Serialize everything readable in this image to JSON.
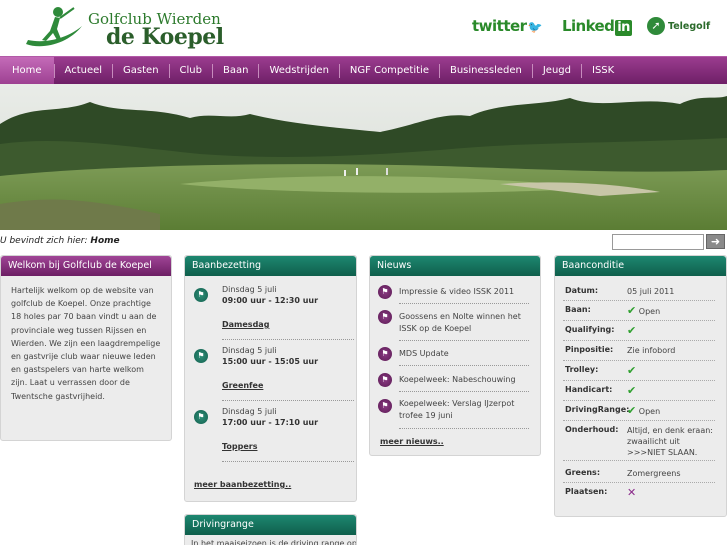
{
  "header": {
    "logo_line1": "Golfclub Wierden",
    "logo_line2": "de Koepel",
    "twitter": "twitter",
    "linkedin": "Linked",
    "linkedin_in": "in",
    "telegolf": "Telegolf"
  },
  "nav": {
    "items": [
      "Home",
      "Actueel",
      "Gasten",
      "Club",
      "Baan",
      "Wedstrijden",
      "NGF Competitie",
      "Businessleden",
      "Jeugd",
      "ISSK"
    ]
  },
  "breadcrumb": {
    "prefix": "U bevindt zich hier: ",
    "current": "Home"
  },
  "search": {
    "value": "",
    "button_icon": "arrow-right-icon"
  },
  "welcome": {
    "title": "Welkom bij Golfclub de Koepel",
    "text": "Hartelijk welkom op de website van golfclub de Koepel. Onze prachtige 18 holes par 70 baan vindt u aan de provinciale weg tussen Rijssen en Wierden. We zijn een laagdrempelige en gastvrije club waar nieuwe leden en gastspelers van harte welkom zijn. Laat u verrassen door de Twentsche gastvrijheid."
  },
  "baanbezetting": {
    "title": "Baanbezetting",
    "entries": [
      {
        "date": "Dinsdag 5 juli",
        "time": "09:00 uur - 12:30 uur",
        "name": "Damesdag"
      },
      {
        "date": "Dinsdag 5 juli",
        "time": "15:00 uur - 15:05 uur",
        "name": "Greenfee"
      },
      {
        "date": "Dinsdag 5 juli",
        "time": "17:00 uur - 17:10 uur",
        "name": "Toppers"
      }
    ],
    "more": "meer baanbezetting.."
  },
  "drivingrange": {
    "title": "Drivingrange",
    "text": "In het maaiseizoen is de driving range op"
  },
  "nieuws": {
    "title": "Nieuws",
    "items": [
      "Impressie & video ISSK 2011",
      "Goossens en Nolte winnen het ISSK op de Koepel",
      "MDS Update",
      "Koepelweek: Nabeschouwing",
      "Koepelweek: Verslag IJzerpot trofee 19 juni"
    ],
    "more": "meer nieuws.."
  },
  "baanconditie": {
    "title": "Baanconditie",
    "rows": [
      {
        "label": "Datum:",
        "value": "05 juli 2011",
        "status": "none"
      },
      {
        "label": "Baan:",
        "value": "Open",
        "status": "check"
      },
      {
        "label": "Qualifying:",
        "value": "",
        "status": "check"
      },
      {
        "label": "Pinpositie:",
        "value": "Zie infobord",
        "status": "none"
      },
      {
        "label": "Trolley:",
        "value": "",
        "status": "check"
      },
      {
        "label": "Handicart:",
        "value": "",
        "status": "check"
      },
      {
        "label": "DrivingRange:",
        "value": "Open",
        "status": "check"
      },
      {
        "label": "Onderhoud:",
        "value": "Altijd, en denk eraan: zwaailicht uit >>>NIET SLAAN.",
        "status": "none"
      },
      {
        "label": "Greens:",
        "value": "Zomergreens",
        "status": "none"
      },
      {
        "label": "Plaatsen:",
        "value": "",
        "status": "cross"
      }
    ]
  },
  "colors": {
    "nav_purple": "#7a2470",
    "panel_teal": "#12705a",
    "check_green": "#2fa02f"
  }
}
